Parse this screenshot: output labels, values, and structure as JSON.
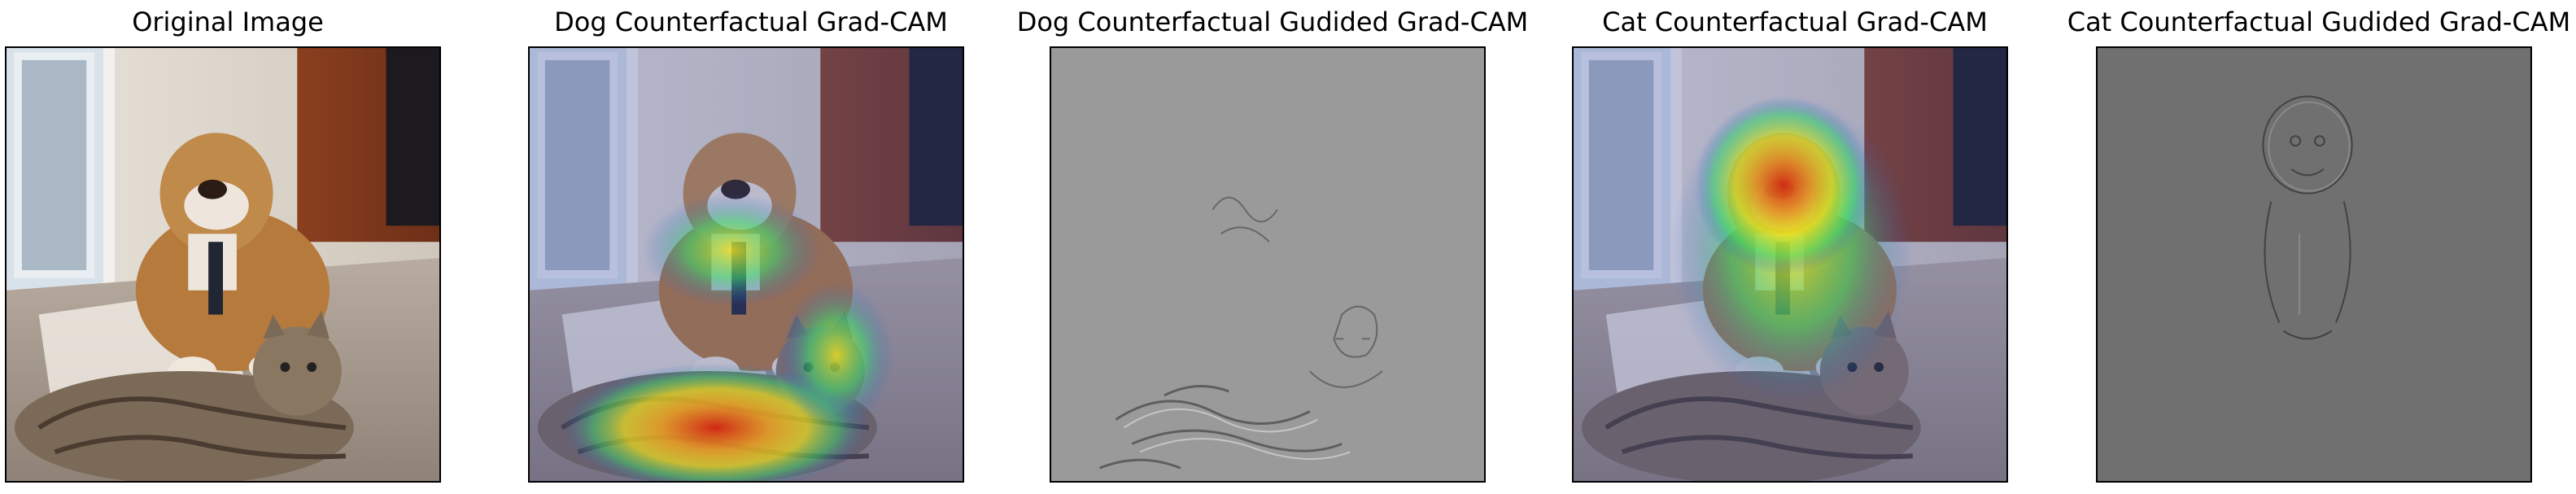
{
  "figure": {
    "panels": [
      {
        "title": "Original Image",
        "kind": "original"
      },
      {
        "title": "Dog Counterfactual Grad-CAM",
        "kind": "gradcam-dog-cf"
      },
      {
        "title": "Dog Counterfactual Gudided Grad-CAM",
        "kind": "guided-dog-cf"
      },
      {
        "title": "Cat Counterfactual Grad-CAM",
        "kind": "gradcam-cat-cf"
      },
      {
        "title": "Cat Counterfactual Gudided Grad-CAM",
        "kind": "guided-cat-cf"
      }
    ],
    "colors": {
      "guided_background_light": "#9a9a9a",
      "guided_background_dark": "#707070",
      "heat_red": "#e0301e",
      "heat_yellow": "#f2e21a",
      "heat_green": "#3fd86a",
      "heat_blue": "#2f5bd6"
    }
  }
}
